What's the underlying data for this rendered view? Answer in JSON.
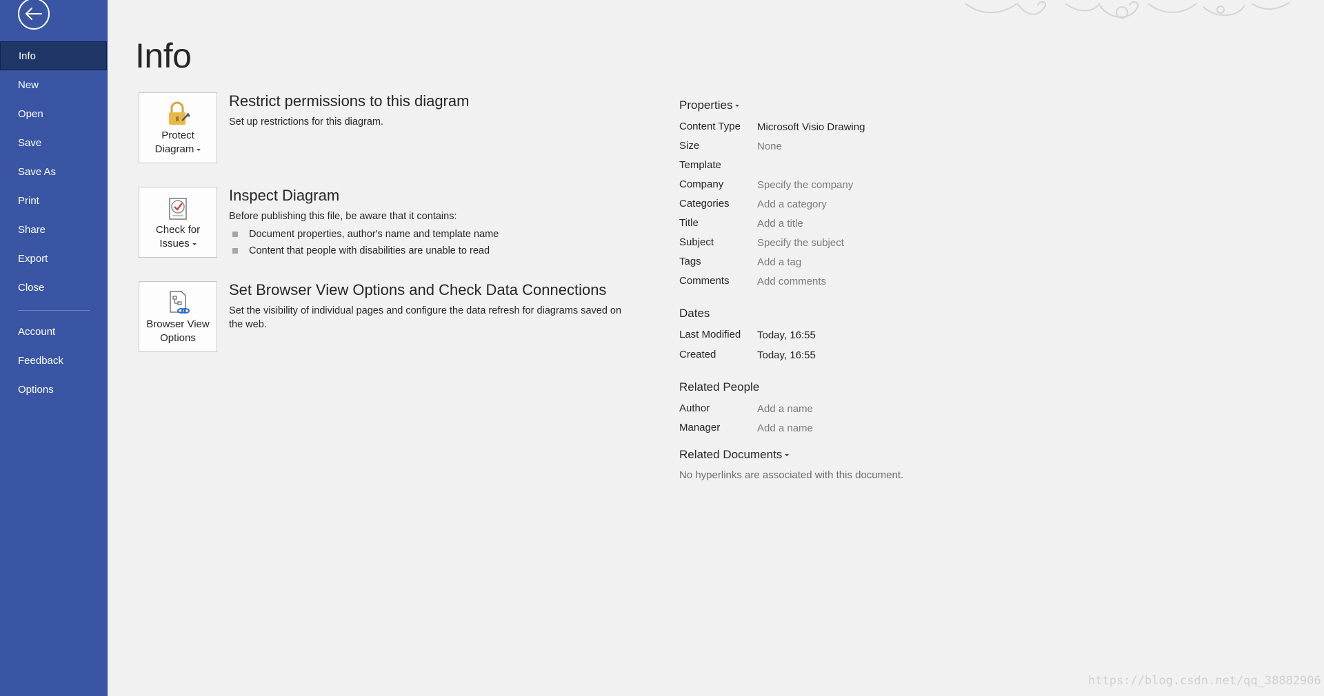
{
  "sidebar": {
    "items": [
      {
        "label": "Info"
      },
      {
        "label": "New"
      },
      {
        "label": "Open"
      },
      {
        "label": "Save"
      },
      {
        "label": "Save As"
      },
      {
        "label": "Print"
      },
      {
        "label": "Share"
      },
      {
        "label": "Export"
      },
      {
        "label": "Close"
      },
      {
        "label": "Account"
      },
      {
        "label": "Feedback"
      },
      {
        "label": "Options"
      }
    ],
    "active": "Info"
  },
  "page": {
    "title": "Info"
  },
  "actions": [
    {
      "tile_line1": "Protect",
      "tile_line2": "Diagram",
      "heading": "Restrict permissions to this diagram",
      "description": "Set up restrictions for this diagram."
    },
    {
      "tile_line1": "Check for",
      "tile_line2": "Issues",
      "heading": "Inspect Diagram",
      "description": "Before publishing this file, be aware that it contains:",
      "bullets": [
        "Document properties, author's name and template name",
        "Content that people with disabilities are unable to read"
      ]
    },
    {
      "tile_line1": "Browser View",
      "tile_line2": "Options",
      "heading": "Set Browser View Options and Check Data Connections",
      "description": "Set the visibility of individual pages and configure the data refresh for diagrams saved on the web."
    }
  ],
  "properties": {
    "heading": "Properties",
    "rows": [
      {
        "label": "Content Type",
        "value": "Microsoft Visio Drawing"
      },
      {
        "label": "Size",
        "value": "None"
      },
      {
        "label": "Template",
        "value": ""
      },
      {
        "label": "Company",
        "value": "Specify the company"
      },
      {
        "label": "Categories",
        "value": "Add a category"
      },
      {
        "label": "Title",
        "value": "Add a title"
      },
      {
        "label": "Subject",
        "value": "Specify the subject"
      },
      {
        "label": "Tags",
        "value": "Add a tag"
      },
      {
        "label": "Comments",
        "value": "Add comments"
      }
    ]
  },
  "dates": {
    "heading": "Dates",
    "rows": [
      {
        "label": "Last Modified",
        "value": "Today, 16:55"
      },
      {
        "label": "Created",
        "value": "Today, 16:55"
      }
    ]
  },
  "related_people": {
    "heading": "Related People",
    "rows": [
      {
        "label": "Author",
        "value": "Add a name"
      },
      {
        "label": "Manager",
        "value": "Add a name"
      }
    ]
  },
  "related_documents": {
    "heading": "Related Documents",
    "empty_text": "No hyperlinks are associated with this document."
  },
  "watermark": "https://blog.csdn.net/qq_38882906",
  "colors": {
    "sidebar_bg": "#3955a3",
    "sidebar_active_bg": "#1f3666",
    "page_bg": "#f1f1f1",
    "placeholder_text": "#7a7a7a"
  }
}
